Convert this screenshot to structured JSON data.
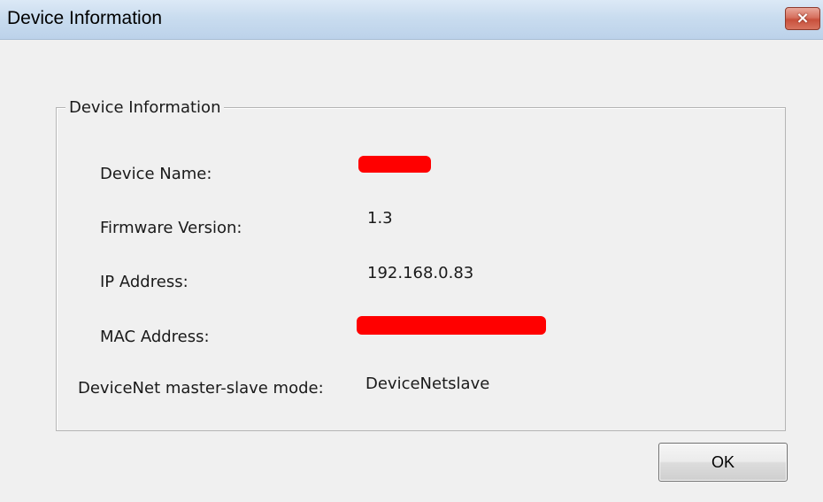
{
  "window": {
    "title": "Device Information",
    "close_glyph": "×",
    "close_icon": "close-icon"
  },
  "group": {
    "label": "Device Information"
  },
  "fields": {
    "device_name_label": "Device Name:",
    "firmware_label": "Firmware Version:",
    "firmware_value": "1.3",
    "ip_label": "IP Address:",
    "ip_value": "192.168.0.83",
    "mac_label": "MAC Address:",
    "mode_label": "DeviceNet master-slave mode:",
    "mode_value": "DeviceNetslave"
  },
  "buttons": {
    "ok_label": "OK"
  },
  "colors": {
    "redaction": "#ff0000",
    "titlebar": "#c9dcef",
    "close_button": "#d6705e"
  }
}
